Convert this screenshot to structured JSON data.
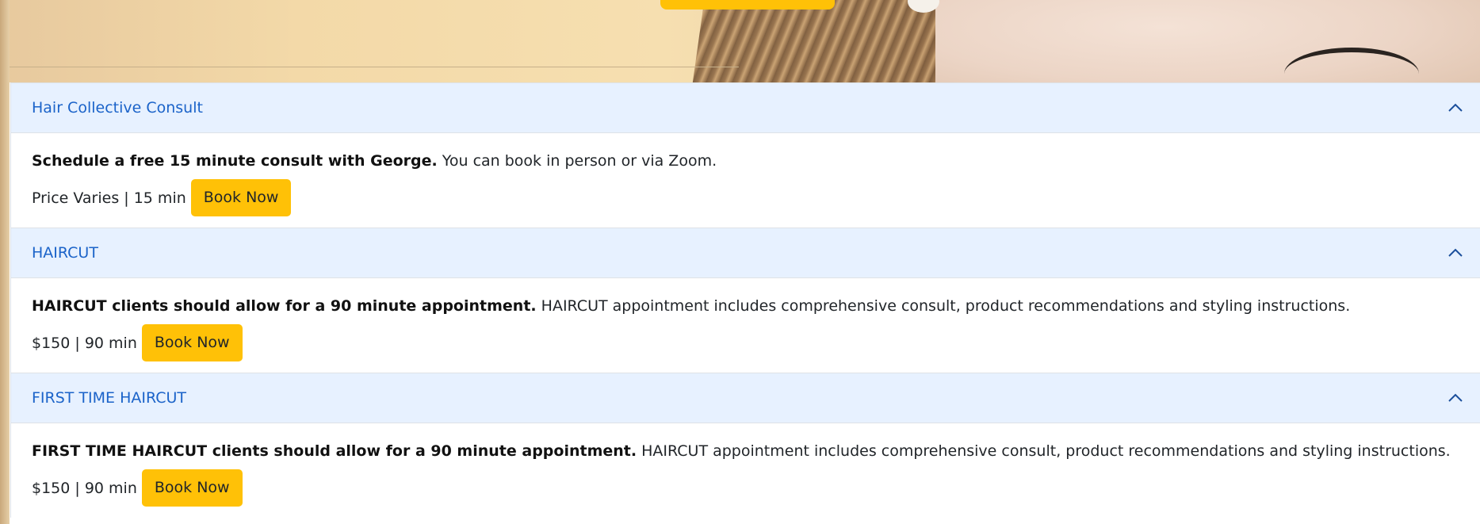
{
  "colors": {
    "accent": "#ffc107",
    "header_bg": "#e7f1ff",
    "header_text": "#1b63c9"
  },
  "services": [
    {
      "title": "Hair Collective Consult",
      "desc_bold": "Schedule a free 15 minute consult with George.",
      "desc_rest": " You can book in person or via Zoom.",
      "meta": "Price Varies | 15 min",
      "button": "Book Now",
      "icon": "chevron-up-icon"
    },
    {
      "title": "HAIRCUT",
      "desc_bold": "HAIRCUT clients should allow for a 90 minute appointment.",
      "desc_rest": " HAIRCUT appointment includes comprehensive consult, product recommendations and styling instructions.",
      "meta": "$150 | 90 min",
      "button": "Book Now",
      "icon": "chevron-up-icon"
    },
    {
      "title": "FIRST TIME HAIRCUT",
      "desc_bold": "FIRST TIME HAIRCUT clients should allow for a 90 minute appointment.",
      "desc_rest": " HAIRCUT appointment includes comprehensive consult, product recommendations and styling instructions.",
      "meta": "$150 | 90 min",
      "button": "Book Now",
      "icon": "chevron-up-icon"
    }
  ]
}
